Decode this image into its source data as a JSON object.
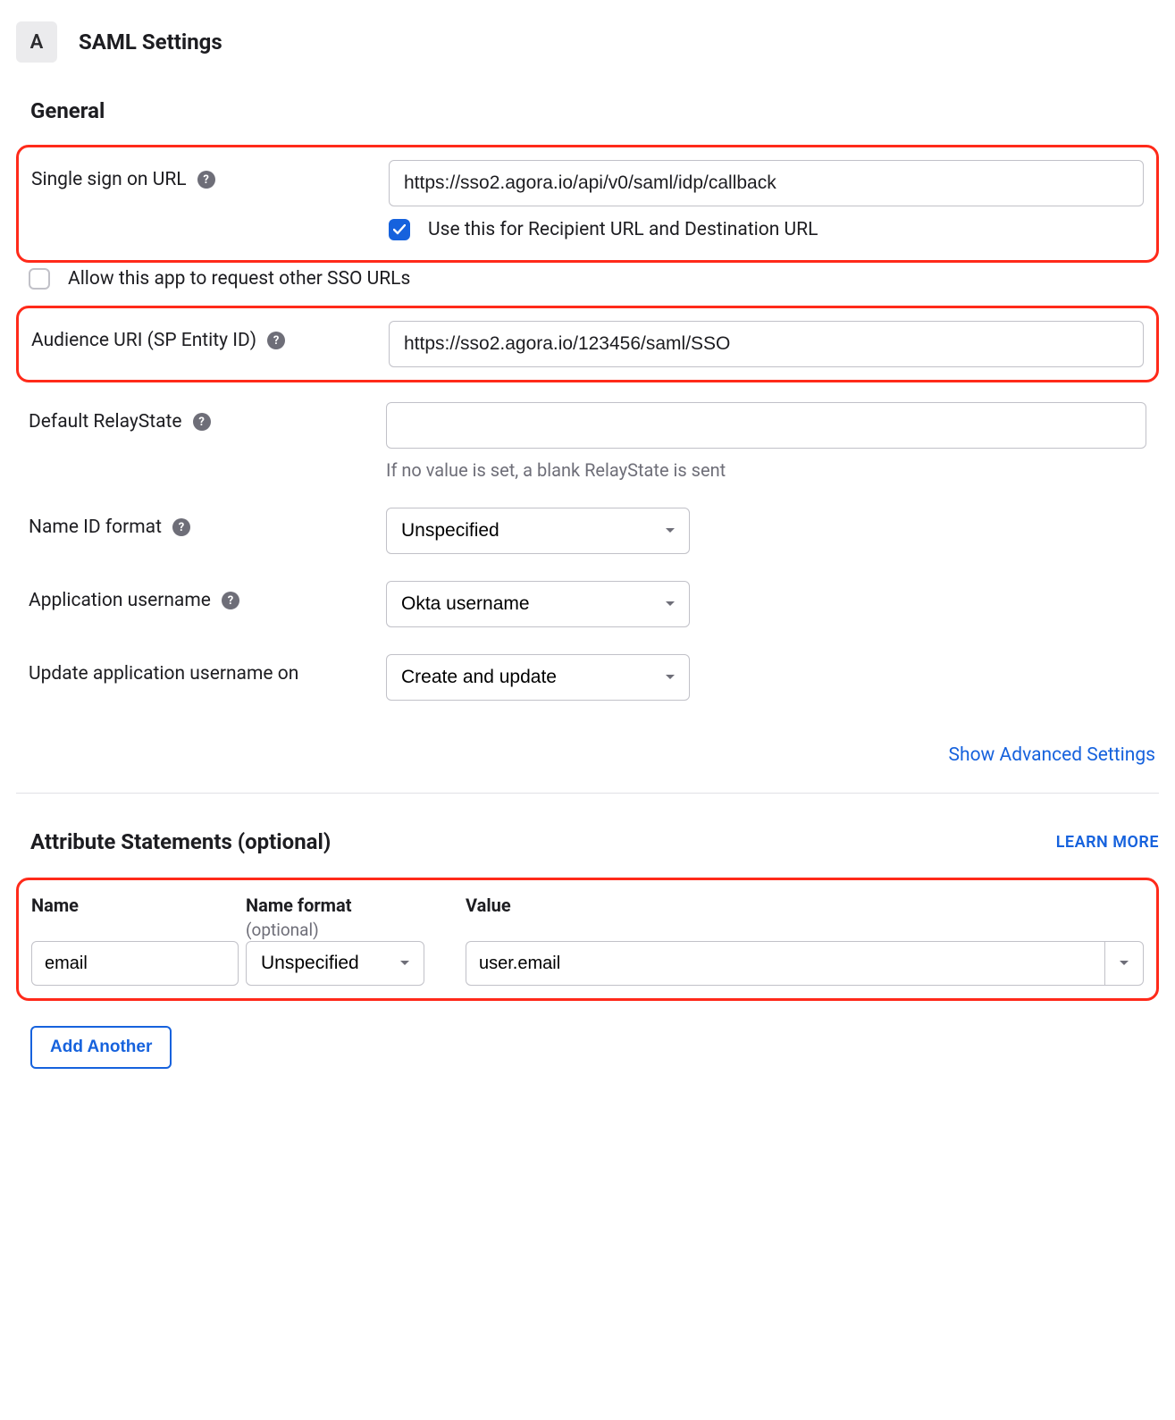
{
  "header": {
    "step": "A",
    "title": "SAML Settings"
  },
  "general": {
    "heading": "General",
    "sso_url": {
      "label": "Single sign on URL",
      "value": "https://sso2.agora.io/api/v0/saml/idp/callback",
      "use_for_recipient_label": "Use this for Recipient URL and Destination URL",
      "use_for_recipient_checked": true,
      "allow_other_label": "Allow this app to request other SSO URLs",
      "allow_other_checked": false
    },
    "audience_uri": {
      "label": "Audience URI (SP Entity ID)",
      "value": "https://sso2.agora.io/123456/saml/SSO"
    },
    "relay_state": {
      "label": "Default RelayState",
      "value": "",
      "hint": "If no value is set, a blank RelayState is sent"
    },
    "name_id_format": {
      "label": "Name ID format",
      "value": "Unspecified"
    },
    "app_username": {
      "label": "Application username",
      "value": "Okta username"
    },
    "update_username_on": {
      "label": "Update application username on",
      "value": "Create and update"
    },
    "show_advanced": "Show Advanced Settings"
  },
  "attributes": {
    "heading": "Attribute Statements (optional)",
    "learn_more": "LEARN MORE",
    "columns": {
      "name": "Name",
      "name_format": "Name format",
      "name_format_opt": "(optional)",
      "value": "Value"
    },
    "row": {
      "name": "email",
      "name_format": "Unspecified",
      "value": "user.email"
    },
    "add_another": "Add Another"
  }
}
